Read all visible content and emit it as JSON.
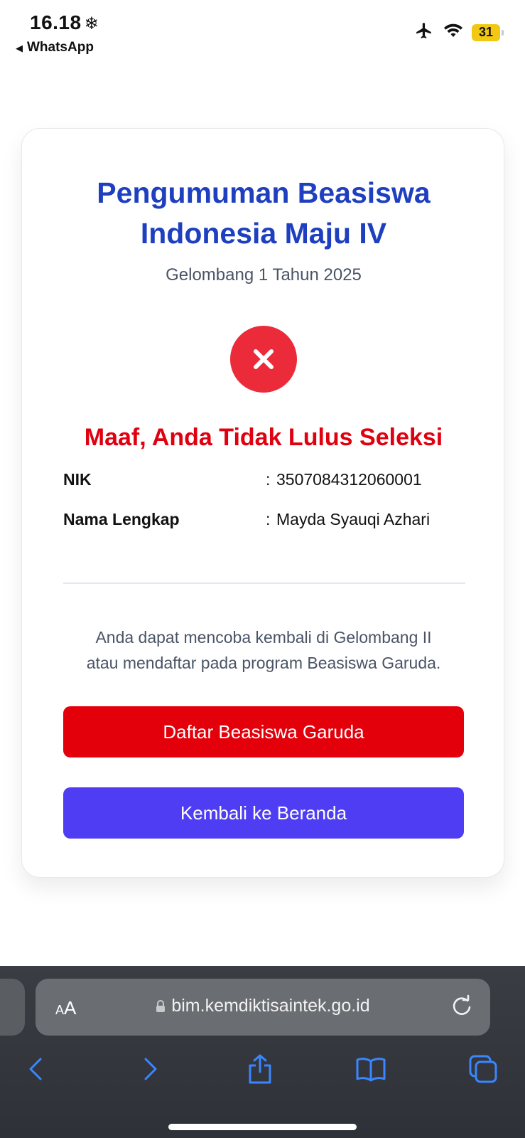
{
  "status_bar": {
    "time": "16.18",
    "weather_icon": "❄",
    "back_app": "WhatsApp",
    "battery_level": "31"
  },
  "card": {
    "title_line1": "Pengumuman Beasiswa",
    "title_line2": "Indonesia Maju IV",
    "subtitle": "Gelombang 1 Tahun 2025",
    "status_icon": "close-icon",
    "result_text": "Maaf, Anda Tidak Lulus Seleksi",
    "fields": [
      {
        "label": "NIK",
        "value": "3507084312060001"
      },
      {
        "label": "Nama Lengkap",
        "value": "Mayda Syauqi Azhari"
      }
    ],
    "note_line1": "Anda dapat mencoba kembali di Gelombang II",
    "note_line2": "atau mendaftar pada program Beasiswa Garuda.",
    "buttons": {
      "garuda": "Daftar Beasiswa Garuda",
      "home": "Kembali ke Beranda"
    }
  },
  "browser": {
    "text_size_label_small": "A",
    "text_size_label_large": "A",
    "url": "bim.kemdiktisaintek.go.id"
  },
  "colors": {
    "title": "#1e3fbf",
    "fail_red": "#e0000f",
    "button_red": "#e3000b",
    "button_purple": "#4f3df4"
  }
}
